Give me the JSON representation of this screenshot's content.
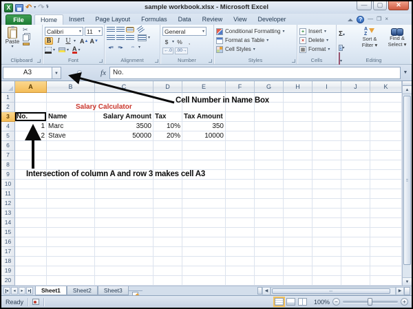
{
  "window": {
    "title": "sample workbook.xlsx - Microsoft Excel"
  },
  "tabs": {
    "file": "File",
    "items": [
      "Home",
      "Insert",
      "Page Layout",
      "Formulas",
      "Data",
      "Review",
      "View",
      "Developer"
    ],
    "active": "Home"
  },
  "ribbon": {
    "clipboard": {
      "label": "Clipboard",
      "paste": "Paste"
    },
    "font": {
      "label": "Font",
      "name": "Calibri",
      "size": "11",
      "bold": "B",
      "italic": "I",
      "underline": "U"
    },
    "alignment": {
      "label": "Alignment"
    },
    "number": {
      "label": "Number",
      "format": "General",
      "currency": "$",
      "percent": "%",
      "comma": ","
    },
    "styles": {
      "label": "Styles",
      "items": [
        "Conditional Formatting",
        "Format as Table",
        "Cell Styles"
      ]
    },
    "cells": {
      "label": "Cells",
      "items": [
        "Insert",
        "Delete",
        "Format"
      ]
    },
    "editing": {
      "label": "Editing",
      "autosum": "Σ",
      "items": [
        "Sort & Filter",
        "Find & Select"
      ]
    }
  },
  "formula_bar": {
    "name_box": "A3",
    "fx_label": "fx",
    "value": "No."
  },
  "grid": {
    "col_headers": [
      "A",
      "B",
      "C",
      "D",
      "E",
      "F",
      "G",
      "H",
      "I",
      "J",
      "K"
    ],
    "row_count": 20,
    "selected_cell": "A3",
    "cells": [
      {
        "c": "B",
        "r": 2,
        "text": "Salary Calculator",
        "cls": "red"
      },
      {
        "c": "A",
        "r": 3,
        "text": "No.",
        "cls": "b"
      },
      {
        "c": "B",
        "r": 3,
        "text": "Name",
        "cls": "b"
      },
      {
        "c": "C",
        "r": 3,
        "text": "Salary Amount",
        "cls": "b r"
      },
      {
        "c": "D",
        "r": 3,
        "text": "Tax",
        "cls": "b"
      },
      {
        "c": "E",
        "r": 3,
        "text": "Tax Amount",
        "cls": "b"
      },
      {
        "c": "A",
        "r": 4,
        "text": "1",
        "cls": "r"
      },
      {
        "c": "B",
        "r": 4,
        "text": "Marc",
        "cls": ""
      },
      {
        "c": "C",
        "r": 4,
        "text": "3500",
        "cls": "r"
      },
      {
        "c": "D",
        "r": 4,
        "text": "10%",
        "cls": "r"
      },
      {
        "c": "E",
        "r": 4,
        "text": "350",
        "cls": "r"
      },
      {
        "c": "A",
        "r": 5,
        "text": "2",
        "cls": "r"
      },
      {
        "c": "B",
        "r": 5,
        "text": "Stave",
        "cls": ""
      },
      {
        "c": "C",
        "r": 5,
        "text": "50000",
        "cls": "r"
      },
      {
        "c": "D",
        "r": 5,
        "text": "20%",
        "cls": "r"
      },
      {
        "c": "E",
        "r": 5,
        "text": "10000",
        "cls": "r"
      }
    ]
  },
  "annotations": {
    "name_box_note": "Cell Number in Name Box",
    "intersection_note": "Intersection of column A and row 3 makes cell A3"
  },
  "sheet_tabs": {
    "items": [
      "Sheet1",
      "Sheet2",
      "Sheet3"
    ],
    "active": "Sheet1"
  },
  "status": {
    "mode": "Ready",
    "zoom_level": "100%"
  }
}
